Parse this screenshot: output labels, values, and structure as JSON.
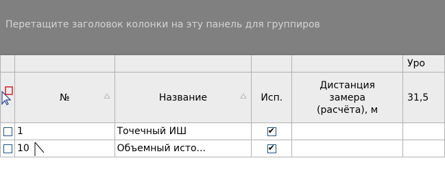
{
  "group_panel": {
    "hint": "Перетащите заголовок колонки на эту панель для группиров"
  },
  "band": {
    "label": "Уро"
  },
  "columns": {
    "num": "№",
    "name": "Название",
    "used": "Исп.",
    "distance_l1": "Дистанция",
    "distance_l2": "замера",
    "distance_l3": "(расчёта), м",
    "freq": "31,5"
  },
  "rows": [
    {
      "num": "1",
      "name": "Точечный ИШ",
      "used": true
    },
    {
      "num": "10",
      "name": "Объемный исто...",
      "used": true
    }
  ],
  "icons": {
    "filter": "filter-cursor-icon",
    "cursor": "mouse-pointer-icon"
  },
  "colors": {
    "panel_bg": "#808080",
    "header_bg": "#ececec",
    "checkbox_border": "#1c5180"
  }
}
